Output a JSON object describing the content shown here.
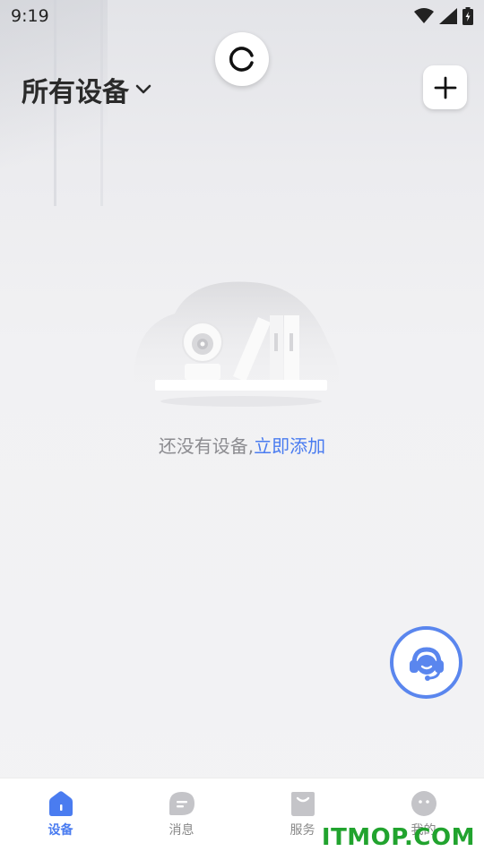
{
  "status_bar": {
    "time": "9:19",
    "icons": [
      "wifi-icon",
      "signal-icon",
      "battery-charging-icon"
    ]
  },
  "header": {
    "title": "所有设备",
    "dropdown_icon": "chevron-down-icon",
    "refresh_icon": "refresh-icon",
    "add_icon": "plus-icon"
  },
  "empty_state": {
    "illustration": "camera-books-shelf-illustration",
    "message": "还没有设备,",
    "link": "立即添加"
  },
  "support": {
    "icon": "headset-icon",
    "accent": "#5a86ee"
  },
  "tabbar": {
    "tabs": [
      {
        "label": "设备",
        "icon": "home-icon",
        "active": true
      },
      {
        "label": "消息",
        "icon": "message-icon",
        "active": false
      },
      {
        "label": "服务",
        "icon": "shopping-bag-icon",
        "active": false
      },
      {
        "label": "我的",
        "icon": "profile-face-icon",
        "active": false
      }
    ],
    "active_color": "#4a7cf0",
    "inactive_color": "#c4c4c8"
  },
  "watermark": {
    "text": "ITMOP.COM",
    "color": "#21a32e"
  }
}
